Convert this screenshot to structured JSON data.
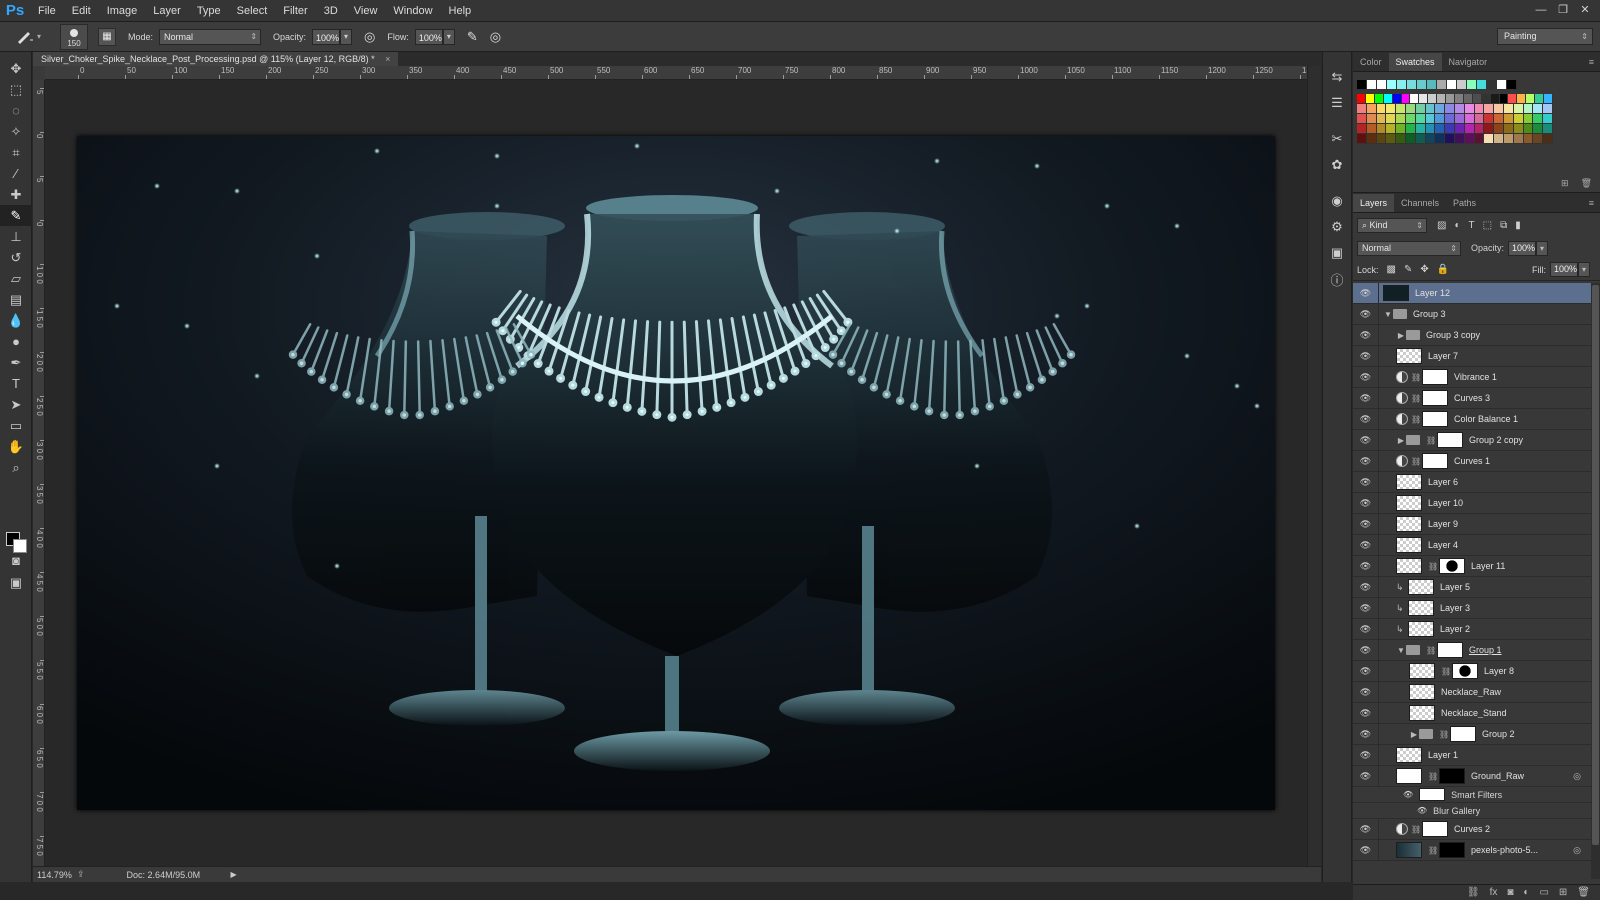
{
  "app": {
    "logo": "Ps"
  },
  "menu": [
    "File",
    "Edit",
    "Image",
    "Layer",
    "Type",
    "Select",
    "Filter",
    "3D",
    "View",
    "Window",
    "Help"
  ],
  "window_controls": [
    "—",
    "❐",
    "✕"
  ],
  "options": {
    "brush_size": "150",
    "mode_label": "Mode:",
    "mode_value": "Normal",
    "opacity_label": "Opacity:",
    "opacity_value": "100%",
    "flow_label": "Flow:",
    "flow_value": "100%",
    "workspace": "Painting"
  },
  "document": {
    "tab_title": "Silver_Choker_Spike_Necklace_Post_Processing.psd @ 115% (Layer 12, RGB/8) *",
    "close": "×"
  },
  "ruler": {
    "h_labels": [
      "0",
      "50",
      "100",
      "150",
      "200",
      "250",
      "300",
      "350",
      "400",
      "450",
      "500",
      "550",
      "600",
      "650",
      "700",
      "750",
      "800",
      "850",
      "900",
      "950",
      "1000",
      "1050",
      "1100",
      "1150",
      "1200",
      "1250",
      "13"
    ],
    "v_labels": [
      "5",
      "0",
      "5",
      "0",
      "1 0 0",
      "1 5 0",
      "2 0 0",
      "2 5 0",
      "3 0 0",
      "3 5 0",
      "4 0 0",
      "4 5 0",
      "5 0 0",
      "5 5 0",
      "6 0 0",
      "6 5 0",
      "7 0 0",
      "7 5 0"
    ]
  },
  "status": {
    "zoom": "114.79%",
    "doc": "Doc: 2.64M/95.0M"
  },
  "panels": {
    "top_tabs": [
      "Color",
      "Swatches",
      "Navigator"
    ],
    "layer_tabs": [
      "Layers",
      "Channels",
      "Paths"
    ],
    "filter_kind": "Kind",
    "blend_mode": "Normal",
    "opacity_label": "Opacity:",
    "opacity_value": "100%",
    "lock_label": "Lock:",
    "fill_label": "Fill:",
    "fill_value": "100%",
    "smart_filters": "Smart Filters",
    "blur_gallery": "Blur Gallery"
  },
  "swatch_colors": [
    [
      "#000000",
      "#ffffff",
      "#ffffff",
      "#9ff",
      "#8ee",
      "#7dd",
      "#6cc",
      "#5bb",
      "#aaa",
      "#fff",
      "#ccc",
      "#8fb",
      "#4dd",
      "#333",
      "#ffffff",
      "#000000"
    ],
    [
      "#ff0000",
      "#ffff00",
      "#00ff00",
      "#00ffff",
      "#0000ff",
      "#ff00ff",
      "#ffffff",
      "#e6e6e6",
      "#cccccc",
      "#b3b3b3",
      "#999999",
      "#808080",
      "#666666",
      "#4d4d4d",
      "#333333",
      "#1a1a1a",
      "#000000",
      "#ff4d4d",
      "#ffb347",
      "#b3ff66",
      "#33cc99",
      "#33b5ff"
    ],
    [
      "#f08080",
      "#f4a460",
      "#ffd966",
      "#f4e96b",
      "#c8e66b",
      "#99d97f",
      "#73cfa1",
      "#66c2cc",
      "#6ca8e0",
      "#8a8ae6",
      "#b38ae6",
      "#e68ae6",
      "#f08ab3",
      "#f5a3a3",
      "#f5c7a3",
      "#f5e6a3",
      "#d9f5a3",
      "#b3f5c7",
      "#a3e6f5",
      "#a3c7f5"
    ],
    [
      "#e05252",
      "#e08a52",
      "#e0b852",
      "#e0d852",
      "#aad852",
      "#6ad86a",
      "#52d8a0",
      "#52c8d8",
      "#5298d8",
      "#6a6ad8",
      "#9a6ad8",
      "#d86ad8",
      "#d86a9a",
      "#cc3333",
      "#cc6633",
      "#cc9933",
      "#cccc33",
      "#88cc33",
      "#33cc66",
      "#33cccc"
    ],
    [
      "#b32424",
      "#b35c24",
      "#b38a24",
      "#b3b324",
      "#6fb324",
      "#24b34a",
      "#24b3a0",
      "#2490b3",
      "#2460b3",
      "#3a3ab3",
      "#6a24b3",
      "#b324b3",
      "#b3246a",
      "#8c1a1a",
      "#8c451a",
      "#8c6b1a",
      "#8c8c1a",
      "#4f8c1a",
      "#1a8c3a",
      "#1a8c7a"
    ],
    [
      "#5c1010",
      "#5c2e10",
      "#5c4510",
      "#5c5c10",
      "#355c10",
      "#105c26",
      "#105c4f",
      "#10455c",
      "#10305c",
      "#1f105c",
      "#3e105c",
      "#5c105c",
      "#5c1033",
      "#f5deb3",
      "#d2b48c",
      "#bc9a6a",
      "#a0784f",
      "#8b5a2b",
      "#6b4423",
      "#4a2e17"
    ]
  ],
  "layers": [
    {
      "name": "Layer 12",
      "type": "pixel",
      "thumb": "dark",
      "selected": true,
      "indent": 0
    },
    {
      "name": "Group 3",
      "type": "group",
      "open": true,
      "indent": 0
    },
    {
      "name": "Group 3 copy",
      "type": "group",
      "open": false,
      "indent": 1
    },
    {
      "name": "Layer 7",
      "type": "pixel",
      "thumb": "checker",
      "indent": 1
    },
    {
      "name": "Vibrance 1",
      "type": "adjust",
      "indent": 1
    },
    {
      "name": "Curves 3",
      "type": "adjust",
      "indent": 1
    },
    {
      "name": "Color Balance 1",
      "type": "adjust",
      "indent": 1
    },
    {
      "name": "Group 2 copy",
      "type": "groupmask",
      "open": false,
      "indent": 1
    },
    {
      "name": "Curves 1",
      "type": "adjust",
      "indent": 1
    },
    {
      "name": "Layer 6",
      "type": "pixel",
      "thumb": "checker",
      "indent": 1
    },
    {
      "name": "Layer 10",
      "type": "pixel",
      "thumb": "checker",
      "indent": 1
    },
    {
      "name": "Layer 9",
      "type": "pixel",
      "thumb": "checker",
      "indent": 1
    },
    {
      "name": "Layer 4",
      "type": "pixel",
      "thumb": "checker",
      "indent": 1
    },
    {
      "name": "Layer 11",
      "type": "pixelmask",
      "thumb": "checker",
      "indent": 1
    },
    {
      "name": "Layer 5",
      "type": "clip",
      "thumb": "checker",
      "indent": 1
    },
    {
      "name": "Layer 3",
      "type": "clip",
      "thumb": "checker",
      "indent": 1
    },
    {
      "name": "Layer 2",
      "type": "clip",
      "thumb": "checker",
      "indent": 1
    },
    {
      "name": "Group 1",
      "type": "groupmask",
      "open": true,
      "underline": true,
      "indent": 1
    },
    {
      "name": "Layer 8",
      "type": "pixelmask",
      "thumb": "checker",
      "indent": 2
    },
    {
      "name": "Necklace_Raw",
      "type": "smart",
      "thumb": "checker",
      "indent": 2
    },
    {
      "name": "Necklace_Stand",
      "type": "smart",
      "thumb": "checker",
      "indent": 2
    },
    {
      "name": "Group 2",
      "type": "groupmask",
      "open": false,
      "indent": 2
    },
    {
      "name": "Layer 1",
      "type": "pixel",
      "thumb": "checker",
      "indent": 1
    },
    {
      "name": "Ground_Raw",
      "type": "smartmask",
      "thumb": "white",
      "indent": 1,
      "fx": true
    },
    {
      "name": "Curves 2",
      "type": "adjust",
      "indent": 1
    },
    {
      "name": "pexels-photo-5...",
      "type": "smartmask",
      "thumb": "photo",
      "indent": 1,
      "fx": true
    }
  ]
}
